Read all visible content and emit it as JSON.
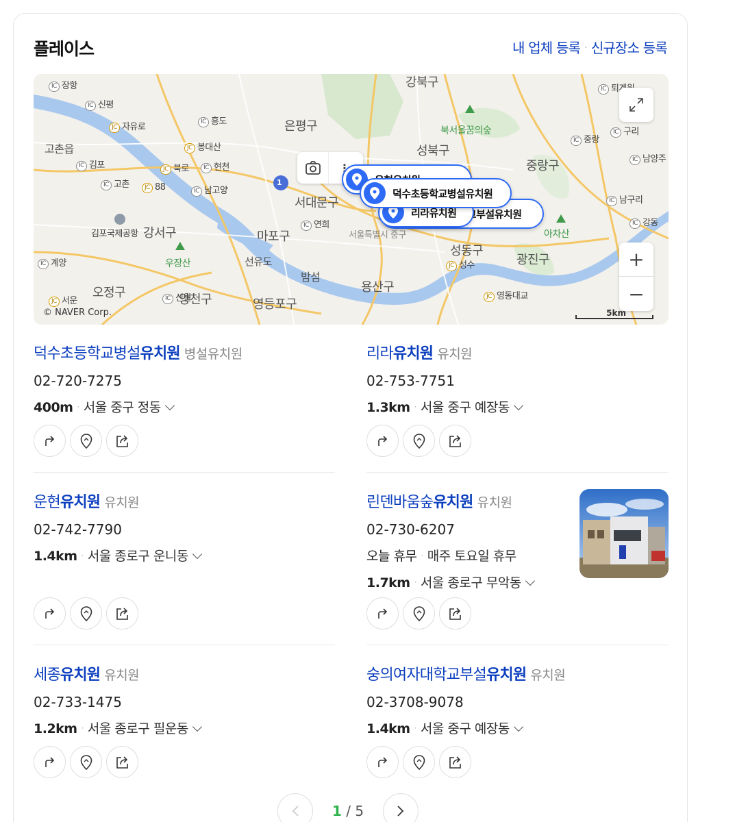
{
  "header": {
    "title": "플레이스",
    "link_register": "내 업체 등록",
    "link_separator": "·",
    "link_new": "신규장소 등록"
  },
  "map": {
    "copyright": "© NAVER Corp.",
    "scale": "5km",
    "districts": [
      "강북구",
      "은평구",
      "성북구",
      "중랑구",
      "서대문구",
      "마포구",
      "성동구",
      "광진구",
      "용산구",
      "영등포구",
      "오정구",
      "양천구",
      "강서구"
    ],
    "places": [
      "북서울꿈의숲",
      "아차산",
      "우장산",
      "고촌읍",
      "선유도",
      "밤섬",
      "서울특별시 중구",
      "김포국제공항"
    ],
    "ic_labels": [
      "장항",
      "신평",
      "자유로",
      "흥도",
      "봉대산",
      "김포",
      "북로",
      "현천",
      "고촌",
      "88",
      "남고양",
      "연희",
      "계양",
      "서운",
      "신월",
      "성수",
      "영동대교",
      "퇴계원",
      "중랑",
      "구리",
      "남양주",
      "남구리",
      "강동",
      "1"
    ],
    "pins": [
      "덕수초등학교병설유치원",
      "리라유치원",
      "운현유치원",
      "숭의여자대학교부설유치원"
    ],
    "zoom_in": "+",
    "zoom_out": "−"
  },
  "results": [
    {
      "name_pre": "덕수초등학교병설",
      "name_bold": "유치원",
      "category": "병설유치원",
      "phone": "02-720-7275",
      "distance": "400m",
      "address": "서울 중구 정동"
    },
    {
      "name_pre": "리라",
      "name_bold": "유치원",
      "category": "유치원",
      "phone": "02-753-7751",
      "distance": "1.3km",
      "address": "서울 중구 예장동"
    },
    {
      "name_pre": "운현",
      "name_bold": "유치원",
      "category": "유치원",
      "phone": "02-742-7790",
      "distance": "1.4km",
      "address": "서울 종로구 운니동"
    },
    {
      "name_pre": "린덴바움숲",
      "name_bold": "유치원",
      "category": "유치원",
      "phone": "02-730-6207",
      "hours_status": "오늘 휴무",
      "hours_note": "매주 토요일 휴무",
      "distance": "1.7km",
      "address": "서울 종로구 무악동"
    },
    {
      "name_pre": "세종",
      "name_bold": "유치원",
      "category": "유치원",
      "phone": "02-733-1475",
      "distance": "1.2km",
      "address": "서울 종로구 필운동"
    },
    {
      "name_pre": "숭의여자대학교부설",
      "name_bold": "유치원",
      "category": "유치원",
      "phone": "02-3708-9078",
      "distance": "1.4km",
      "address": "서울 중구 예장동"
    }
  ],
  "sep": "·",
  "pagination": {
    "current": "1",
    "divider": "/",
    "total": "5"
  },
  "colors": {
    "link": "#0b3ebe",
    "pin": "#2d6af6",
    "page_current": "#2eb24c",
    "river": "#a9c8ee",
    "road": "#f4c766"
  }
}
